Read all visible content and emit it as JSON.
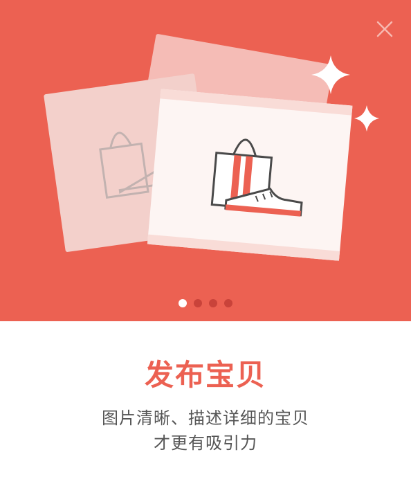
{
  "colors": {
    "accent": "#ec6152",
    "dot_inactive": "#c9433a",
    "dot_active": "#ffffff",
    "text_body": "#555555"
  },
  "header": {
    "close_icon": "close-icon"
  },
  "illustration": {
    "icons": [
      "shopping-bag-icon",
      "sneaker-icon",
      "sparkle-icon"
    ]
  },
  "pager": {
    "total": 4,
    "active_index": 0
  },
  "content": {
    "title": "发布宝贝",
    "desc_line1": "图片清晰、描述详细的宝贝",
    "desc_line2": "才更有吸引力"
  }
}
